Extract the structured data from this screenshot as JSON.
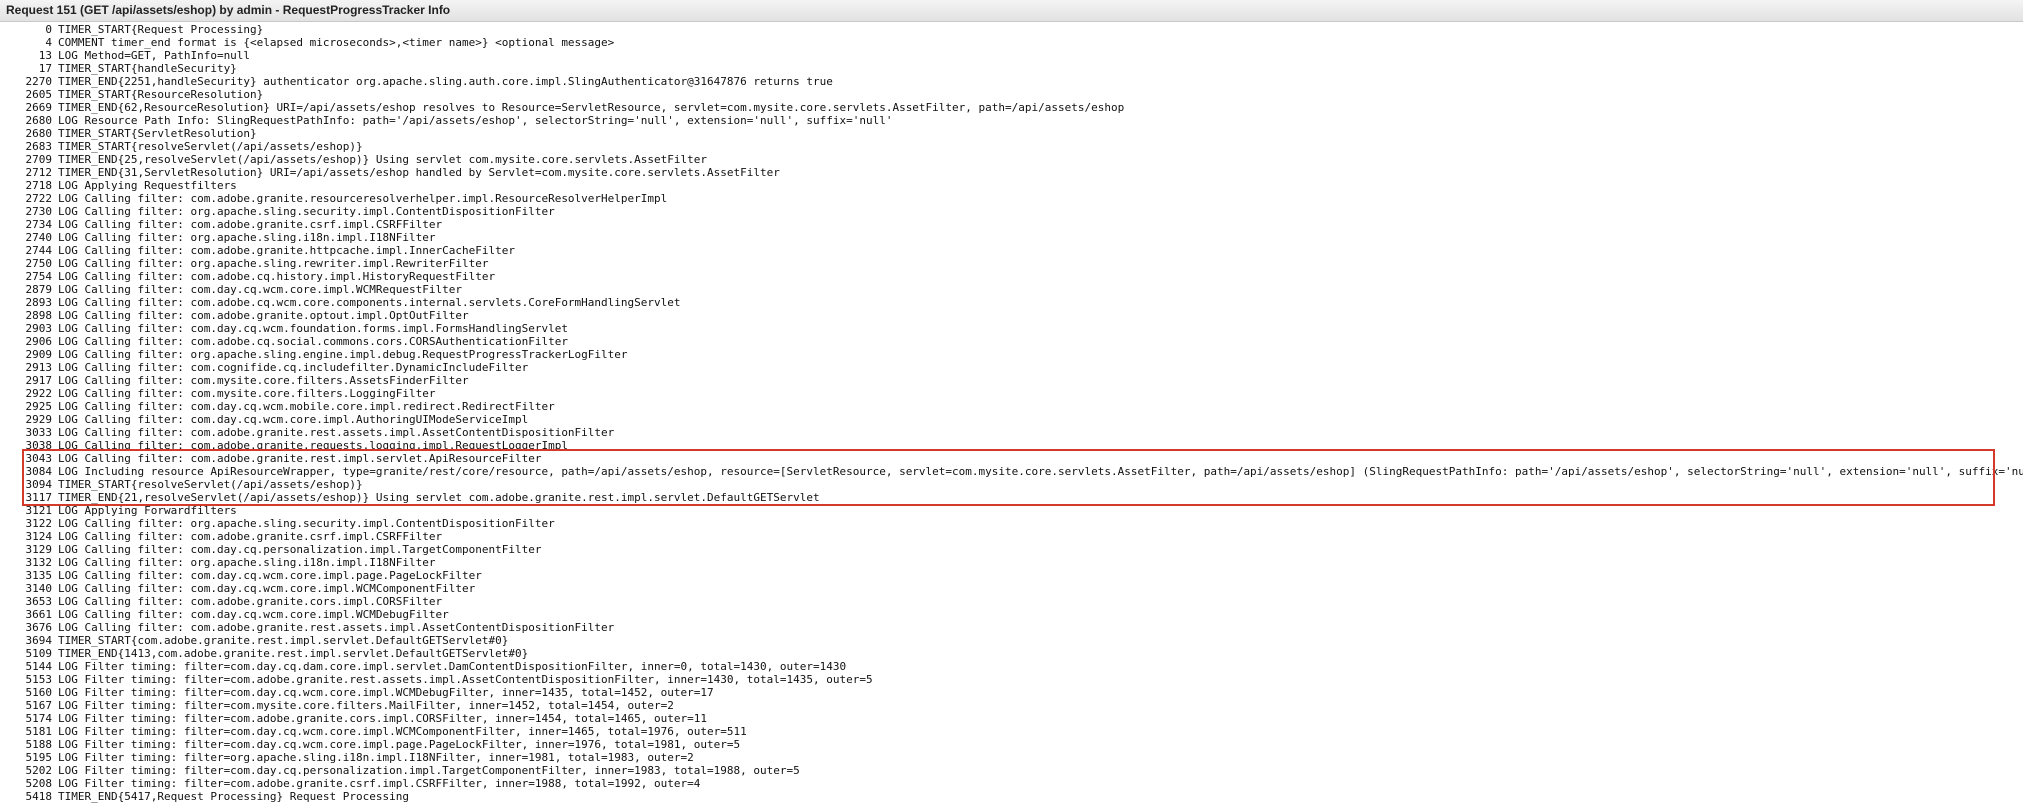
{
  "window": {
    "title": "Request 151 (GET /api/assets/eshop) by admin - RequestProgressTracker Info"
  },
  "highlight": {
    "color": "#d33a2b"
  },
  "lines": [
    {
      "t": "0",
      "m": "TIMER_START{Request Processing}"
    },
    {
      "t": "4",
      "m": "COMMENT timer_end format is {<elapsed microseconds>,<timer name>} <optional message>"
    },
    {
      "t": "13",
      "m": "LOG Method=GET, PathInfo=null"
    },
    {
      "t": "17",
      "m": "TIMER_START{handleSecurity}"
    },
    {
      "t": "2270",
      "m": "TIMER_END{2251,handleSecurity} authenticator org.apache.sling.auth.core.impl.SlingAuthenticator@31647876 returns true"
    },
    {
      "t": "2605",
      "m": "TIMER_START{ResourceResolution}"
    },
    {
      "t": "2669",
      "m": "TIMER_END{62,ResourceResolution} URI=/api/assets/eshop resolves to Resource=ServletResource, servlet=com.mysite.core.servlets.AssetFilter, path=/api/assets/eshop"
    },
    {
      "t": "2680",
      "m": "LOG Resource Path Info: SlingRequestPathInfo: path='/api/assets/eshop', selectorString='null', extension='null', suffix='null'"
    },
    {
      "t": "2680",
      "m": "TIMER_START{ServletResolution}"
    },
    {
      "t": "2683",
      "m": "TIMER_START{resolveServlet(/api/assets/eshop)}"
    },
    {
      "t": "2709",
      "m": "TIMER_END{25,resolveServlet(/api/assets/eshop)} Using servlet com.mysite.core.servlets.AssetFilter"
    },
    {
      "t": "2712",
      "m": "TIMER_END{31,ServletResolution} URI=/api/assets/eshop handled by Servlet=com.mysite.core.servlets.AssetFilter"
    },
    {
      "t": "2718",
      "m": "LOG Applying Requestfilters"
    },
    {
      "t": "2722",
      "m": "LOG Calling filter: com.adobe.granite.resourceresolverhelper.impl.ResourceResolverHelperImpl"
    },
    {
      "t": "2730",
      "m": "LOG Calling filter: org.apache.sling.security.impl.ContentDispositionFilter"
    },
    {
      "t": "2734",
      "m": "LOG Calling filter: com.adobe.granite.csrf.impl.CSRFFilter"
    },
    {
      "t": "2740",
      "m": "LOG Calling filter: org.apache.sling.i18n.impl.I18NFilter"
    },
    {
      "t": "2744",
      "m": "LOG Calling filter: com.adobe.granite.httpcache.impl.InnerCacheFilter"
    },
    {
      "t": "2750",
      "m": "LOG Calling filter: org.apache.sling.rewriter.impl.RewriterFilter"
    },
    {
      "t": "2754",
      "m": "LOG Calling filter: com.adobe.cq.history.impl.HistoryRequestFilter"
    },
    {
      "t": "2879",
      "m": "LOG Calling filter: com.day.cq.wcm.core.impl.WCMRequestFilter"
    },
    {
      "t": "2893",
      "m": "LOG Calling filter: com.adobe.cq.wcm.core.components.internal.servlets.CoreFormHandlingServlet"
    },
    {
      "t": "2898",
      "m": "LOG Calling filter: com.adobe.granite.optout.impl.OptOutFilter"
    },
    {
      "t": "2903",
      "m": "LOG Calling filter: com.day.cq.wcm.foundation.forms.impl.FormsHandlingServlet"
    },
    {
      "t": "2906",
      "m": "LOG Calling filter: com.adobe.cq.social.commons.cors.CORSAuthenticationFilter"
    },
    {
      "t": "2909",
      "m": "LOG Calling filter: org.apache.sling.engine.impl.debug.RequestProgressTrackerLogFilter"
    },
    {
      "t": "2913",
      "m": "LOG Calling filter: com.cognifide.cq.includefilter.DynamicIncludeFilter"
    },
    {
      "t": "2917",
      "m": "LOG Calling filter: com.mysite.core.filters.AssetsFinderFilter"
    },
    {
      "t": "2922",
      "m": "LOG Calling filter: com.mysite.core.filters.LoggingFilter"
    },
    {
      "t": "2925",
      "m": "LOG Calling filter: com.day.cq.wcm.mobile.core.impl.redirect.RedirectFilter"
    },
    {
      "t": "2929",
      "m": "LOG Calling filter: com.day.cq.wcm.core.impl.AuthoringUIModeServiceImpl"
    },
    {
      "t": "3033",
      "m": "LOG Calling filter: com.adobe.granite.rest.assets.impl.AssetContentDispositionFilter"
    },
    {
      "t": "3038",
      "m": "LOG Calling filter: com.adobe.granite.requests.logging.impl.RequestLoggerImpl"
    },
    {
      "t": "3043",
      "m": "LOG Calling filter: com.adobe.granite.rest.impl.servlet.ApiResourceFilter"
    },
    {
      "t": "3084",
      "m": "LOG Including resource ApiResourceWrapper, type=granite/rest/core/resource, path=/api/assets/eshop, resource=[ServletResource, servlet=com.mysite.core.servlets.AssetFilter, path=/api/assets/eshop] (SlingRequestPathInfo: path='/api/assets/eshop', selectorString='null', extension='null', suffix='null')"
    },
    {
      "t": "3094",
      "m": "TIMER_START{resolveServlet(/api/assets/eshop)}"
    },
    {
      "t": "3117",
      "m": "TIMER_END{21,resolveServlet(/api/assets/eshop)} Using servlet com.adobe.granite.rest.impl.servlet.DefaultGETServlet"
    },
    {
      "t": "3121",
      "m": "LOG Applying Forwardfilters"
    },
    {
      "t": "3122",
      "m": "LOG Calling filter: org.apache.sling.security.impl.ContentDispositionFilter"
    },
    {
      "t": "3124",
      "m": "LOG Calling filter: com.adobe.granite.csrf.impl.CSRFFilter"
    },
    {
      "t": "3129",
      "m": "LOG Calling filter: com.day.cq.personalization.impl.TargetComponentFilter"
    },
    {
      "t": "3132",
      "m": "LOG Calling filter: org.apache.sling.i18n.impl.I18NFilter"
    },
    {
      "t": "3135",
      "m": "LOG Calling filter: com.day.cq.wcm.core.impl.page.PageLockFilter"
    },
    {
      "t": "3140",
      "m": "LOG Calling filter: com.day.cq.wcm.core.impl.WCMComponentFilter"
    },
    {
      "t": "3653",
      "m": "LOG Calling filter: com.adobe.granite.cors.impl.CORSFilter"
    },
    {
      "t": "3661",
      "m": "LOG Calling filter: com.day.cq.wcm.core.impl.WCMDebugFilter"
    },
    {
      "t": "3676",
      "m": "LOG Calling filter: com.adobe.granite.rest.assets.impl.AssetContentDispositionFilter"
    },
    {
      "t": "3694",
      "m": "TIMER_START{com.adobe.granite.rest.impl.servlet.DefaultGETServlet#0}"
    },
    {
      "t": "5109",
      "m": "TIMER_END{1413,com.adobe.granite.rest.impl.servlet.DefaultGETServlet#0}"
    },
    {
      "t": "5144",
      "m": "LOG Filter timing: filter=com.day.cq.dam.core.impl.servlet.DamContentDispositionFilter, inner=0, total=1430, outer=1430"
    },
    {
      "t": "5153",
      "m": "LOG Filter timing: filter=com.adobe.granite.rest.assets.impl.AssetContentDispositionFilter, inner=1430, total=1435, outer=5"
    },
    {
      "t": "5160",
      "m": "LOG Filter timing: filter=com.day.cq.wcm.core.impl.WCMDebugFilter, inner=1435, total=1452, outer=17"
    },
    {
      "t": "5167",
      "m": "LOG Filter timing: filter=com.mysite.core.filters.MailFilter, inner=1452, total=1454, outer=2"
    },
    {
      "t": "5174",
      "m": "LOG Filter timing: filter=com.adobe.granite.cors.impl.CORSFilter, inner=1454, total=1465, outer=11"
    },
    {
      "t": "5181",
      "m": "LOG Filter timing: filter=com.day.cq.wcm.core.impl.WCMComponentFilter, inner=1465, total=1976, outer=511"
    },
    {
      "t": "5188",
      "m": "LOG Filter timing: filter=com.day.cq.wcm.core.impl.page.PageLockFilter, inner=1976, total=1981, outer=5"
    },
    {
      "t": "5195",
      "m": "LOG Filter timing: filter=org.apache.sling.i18n.impl.I18NFilter, inner=1981, total=1983, outer=2"
    },
    {
      "t": "5202",
      "m": "LOG Filter timing: filter=com.day.cq.personalization.impl.TargetComponentFilter, inner=1983, total=1988, outer=5"
    },
    {
      "t": "5208",
      "m": "LOG Filter timing: filter=com.adobe.granite.csrf.impl.CSRFFilter, inner=1988, total=1992, outer=4"
    },
    {
      "t": "5418",
      "m": "TIMER_END{5417,Request Processing} Request Processing"
    }
  ]
}
